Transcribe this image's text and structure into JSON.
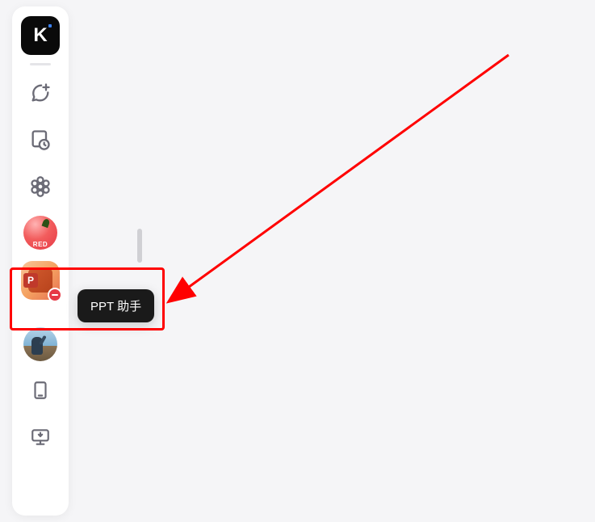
{
  "sidebar": {
    "logo_letter": "K",
    "items": {
      "red_label": "RED",
      "ppt_letter": "P"
    }
  },
  "tooltip": {
    "label": "PPT 助手"
  }
}
